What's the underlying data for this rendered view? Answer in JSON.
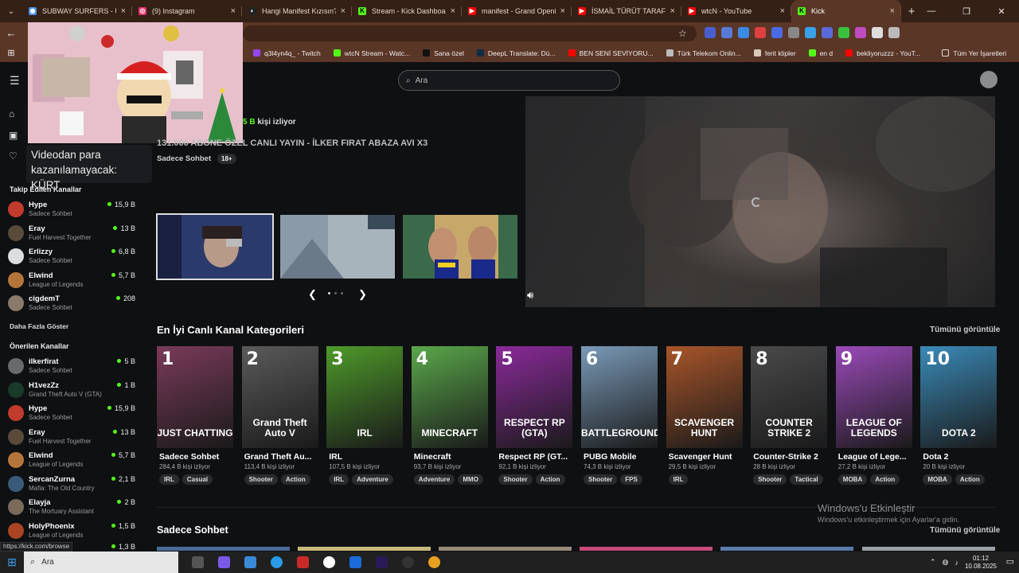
{
  "browser": {
    "tabs": [
      {
        "title": "SUBWAY SURFERS - Ücret",
        "color": "#4a90e2",
        "glyph": "◉"
      },
      {
        "title": "(9) Instagram",
        "color": "#e1306c",
        "glyph": "◎"
      },
      {
        "title": "Hangi Manifest Kızısın? -",
        "color": "#222222",
        "glyph": "◐"
      },
      {
        "title": "Stream - Kick Dashboard",
        "color": "#53fc18",
        "glyph": "K"
      },
      {
        "title": "manifest - Grand Opening",
        "color": "#ff0000",
        "glyph": "▶"
      },
      {
        "title": "İSMAİL TÜRÜT TARAFIND",
        "color": "#ff0000",
        "glyph": "▶"
      },
      {
        "title": "wtcN - YouTube",
        "color": "#ff0000",
        "glyph": "▶"
      },
      {
        "title": "Kick",
        "color": "#53fc18",
        "glyph": "K",
        "active": true
      }
    ],
    "new_tab": "+",
    "bookmarks": [
      {
        "label": "q3l4yn4q_ - Twitch",
        "color": "#9146ff"
      },
      {
        "label": "wtcN Stream - Watc...",
        "color": "#53fc18"
      },
      {
        "label": "Sana özel",
        "color": "#111111"
      },
      {
        "label": "DeepL Translate: Dü...",
        "color": "#0f2b46"
      },
      {
        "label": "BEN SENİ SEVİYORU...",
        "color": "#ff0000"
      },
      {
        "label": "Türk Telekom Onlin...",
        "color": "#bbbbbb"
      },
      {
        "label": "ferit klipler",
        "color": "#d9c9b9"
      },
      {
        "label": "en d",
        "color": "#53fc18"
      },
      {
        "label": "bekliyoruzzz - YouT...",
        "color": "#ff0000"
      }
    ],
    "all_bookmarks": "Tüm Yer İşaretleri"
  },
  "header": {
    "search_placeholder": "Ara"
  },
  "tooltip": "Videodan para kazanılamayacak: KÜRT",
  "sidebar": {
    "followed_title": "Takip Edilen Kanallar",
    "followed": [
      {
        "name": "Hype",
        "category": "Sadece Sohbet",
        "viewers": "15,9 B",
        "color": "#c23a2b"
      },
      {
        "name": "Eray",
        "category": "Fuel Harvest Together",
        "viewers": "13 B",
        "color": "#5a4a3a"
      },
      {
        "name": "Erlizzy",
        "category": "Sadece Sohbet",
        "viewers": "6,8 B",
        "color": "#dddddd"
      },
      {
        "name": "Elwind",
        "category": "League of Legends",
        "viewers": "5,7 B",
        "color": "#b5753a"
      },
      {
        "name": "cigdemT",
        "category": "Sadece Sohbet",
        "viewers": "208",
        "color": "#8a7a6a"
      }
    ],
    "show_more": "Daha Fazla Göster",
    "recommended_title": "Önerilen Kanallar",
    "recommended": [
      {
        "name": "ilkerfirat",
        "category": "Sadece Sohbet",
        "viewers": "5 B",
        "color": "#6a6a6a"
      },
      {
        "name": "H1vezZz",
        "category": "Grand Theft Auto V (GTA)",
        "viewers": "1 B",
        "color": "#1a3a2a"
      },
      {
        "name": "Hype",
        "category": "Sadece Sohbet",
        "viewers": "15,9 B",
        "color": "#c23a2b"
      },
      {
        "name": "Eray",
        "category": "Fuel Harvest Together",
        "viewers": "13 B",
        "color": "#5a4a3a"
      },
      {
        "name": "Elwind",
        "category": "League of Legends",
        "viewers": "5,7 B",
        "color": "#b5753a"
      },
      {
        "name": "SercanZurna",
        "category": "Mafia: The Old Country",
        "viewers": "2,1 B",
        "color": "#3a5a7a"
      },
      {
        "name": "Elayja",
        "category": "The Mortuary Assistant",
        "viewers": "2 B",
        "color": "#7a6a5a"
      },
      {
        "name": "HolyPhoenix",
        "category": "League of Legends",
        "viewers": "1,5 B",
        "color": "#aa4422"
      }
    ],
    "partial_viewers": "1,3 B"
  },
  "hero": {
    "viewers_count": "5 B",
    "viewers_suffix": "kişi izliyor",
    "title": "131.000 ABONE ÖZEL CANLI YAYIN - İLKER FIRAT ABAZA AVI X3",
    "category": "Sadece Sohbet",
    "tag": "18+"
  },
  "categories": {
    "title": "En İyi Canlı Kanal Kategorileri",
    "view_all": "Tümünü görüntüle",
    "items": [
      {
        "rank": "1",
        "name": "Sadece Sohbet",
        "viewers": "284,4 B kişi izliyor",
        "tags": [
          "IRL",
          "Casual"
        ],
        "logo": "JUST CHATTING",
        "bg": "#7a3a5a"
      },
      {
        "rank": "2",
        "name": "Grand Theft Au...",
        "viewers": "113,4 B kişi izliyor",
        "tags": [
          "Shooter",
          "Action"
        ],
        "logo": "Grand Theft Auto V",
        "bg": "#5a5a5a"
      },
      {
        "rank": "3",
        "name": "IRL",
        "viewers": "107,5 B kişi izliyor",
        "tags": [
          "IRL",
          "Adventure"
        ],
        "logo": "IRL",
        "bg": "#4e9a2a"
      },
      {
        "rank": "4",
        "name": "Minecraft",
        "viewers": "93,7 B kişi izliyor",
        "tags": [
          "Adventure",
          "MMO"
        ],
        "logo": "MINECRAFT",
        "bg": "#5aa84a"
      },
      {
        "rank": "5",
        "name": "Respect RP (GT...",
        "viewers": "92,1 B kişi izliyor",
        "tags": [
          "Shooter",
          "Action"
        ],
        "logo": "RESPECT RP (GTA)",
        "bg": "#8a2a9a"
      },
      {
        "rank": "6",
        "name": "PUBG Mobile",
        "viewers": "74,3 B kişi izliyor",
        "tags": [
          "Shooter",
          "FPS"
        ],
        "logo": "BATTLEGROUNDS",
        "bg": "#7a9ab8"
      },
      {
        "rank": "7",
        "name": "Scavenger Hunt",
        "viewers": "29,5 B kişi izliyor",
        "tags": [
          "IRL"
        ],
        "logo": "SCAVENGER HUNT",
        "bg": "#a8552a"
      },
      {
        "rank": "8",
        "name": "Counter-Strike 2",
        "viewers": "28 B kişi izliyor",
        "tags": [
          "Shooter",
          "Tactical"
        ],
        "logo": "COUNTER STRIKE 2",
        "bg": "#4a4a4a"
      },
      {
        "rank": "9",
        "name": "League of Lege...",
        "viewers": "27,2 B kişi izliyor",
        "tags": [
          "MOBA",
          "Action"
        ],
        "logo": "LEAGUE OF LEGENDS",
        "bg": "#9a4ab8"
      },
      {
        "rank": "10",
        "name": "Dota 2",
        "viewers": "20 B kişi izliyor",
        "tags": [
          "MOBA",
          "Action"
        ],
        "logo": "DOTA 2",
        "bg": "#3a8ab8"
      }
    ]
  },
  "section2": {
    "title": "Sadece Sohbet",
    "view_all": "Tümünü görüntüle"
  },
  "windows": {
    "watermark_title": "Windows'u Etkinleştir",
    "watermark_sub": "Windows'u etkinleştirmek için Ayarlar'a gidin.",
    "status_url": "https://kick.com/browse",
    "taskbar_search": "Ara",
    "time": "01:12",
    "date": "10.08.2025"
  }
}
